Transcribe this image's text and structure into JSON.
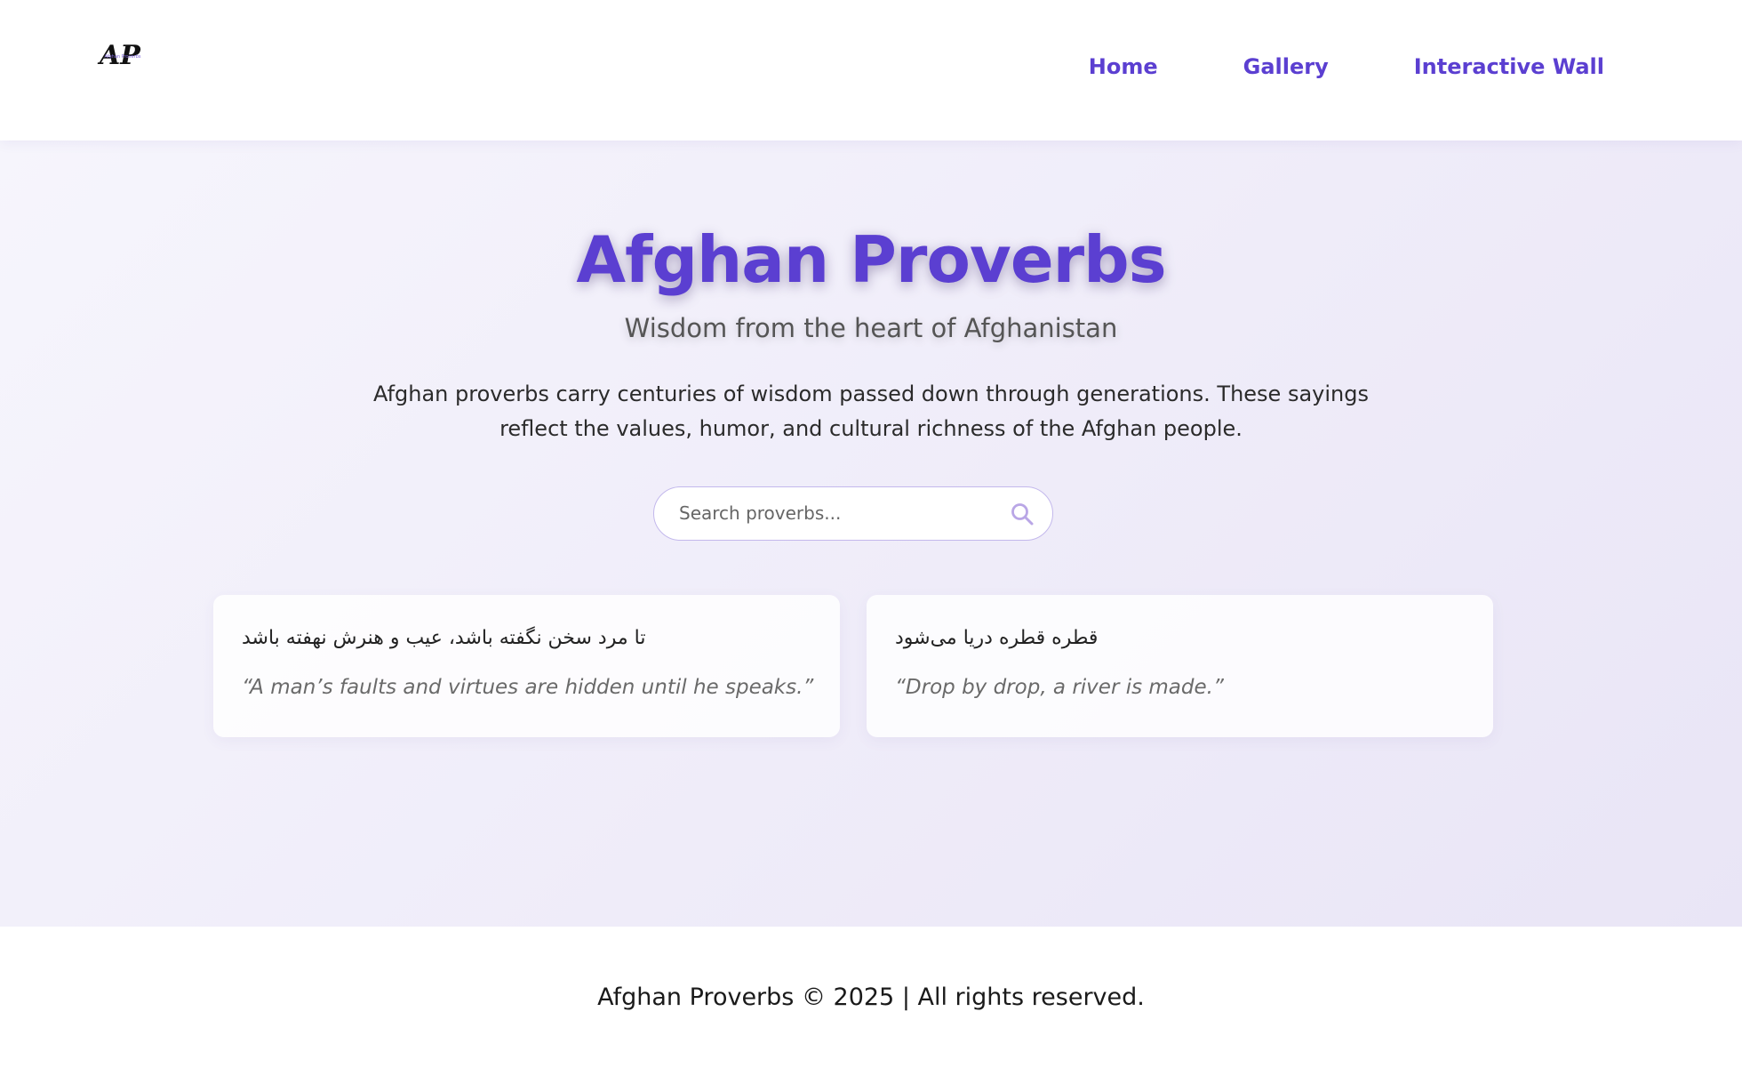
{
  "header": {
    "logo_text": "AP",
    "logo_caption": "Afghan Proverbs",
    "nav": [
      {
        "label": "Home"
      },
      {
        "label": "Gallery"
      },
      {
        "label": "Interactive Wall"
      }
    ]
  },
  "hero": {
    "title": "Afghan Proverbs",
    "subtitle": "Wisdom from the heart of Afghanistan",
    "description": "Afghan proverbs carry centuries of wisdom passed down through generations. These sayings reflect the values, humor, and cultural richness of the Afghan people."
  },
  "search": {
    "placeholder": "Search proverbs...",
    "value": "",
    "icon": "search-icon"
  },
  "proverbs": [
    {
      "farsi": "تا مرد سخن نگفته باشد، عیب و هنرش نهفته باشد",
      "english": "“A man’s faults and virtues are hidden until he speaks.”"
    },
    {
      "farsi": "قطره قطره دریا می‌شود",
      "english": "“Drop by drop, a river is made.”"
    }
  ],
  "footer": {
    "text": "Afghan Proverbs © 2025 | All rights reserved."
  },
  "colors": {
    "accent": "#5b3fd1",
    "search_border": "#c3b8ec",
    "background_tint": "#efecf9"
  }
}
